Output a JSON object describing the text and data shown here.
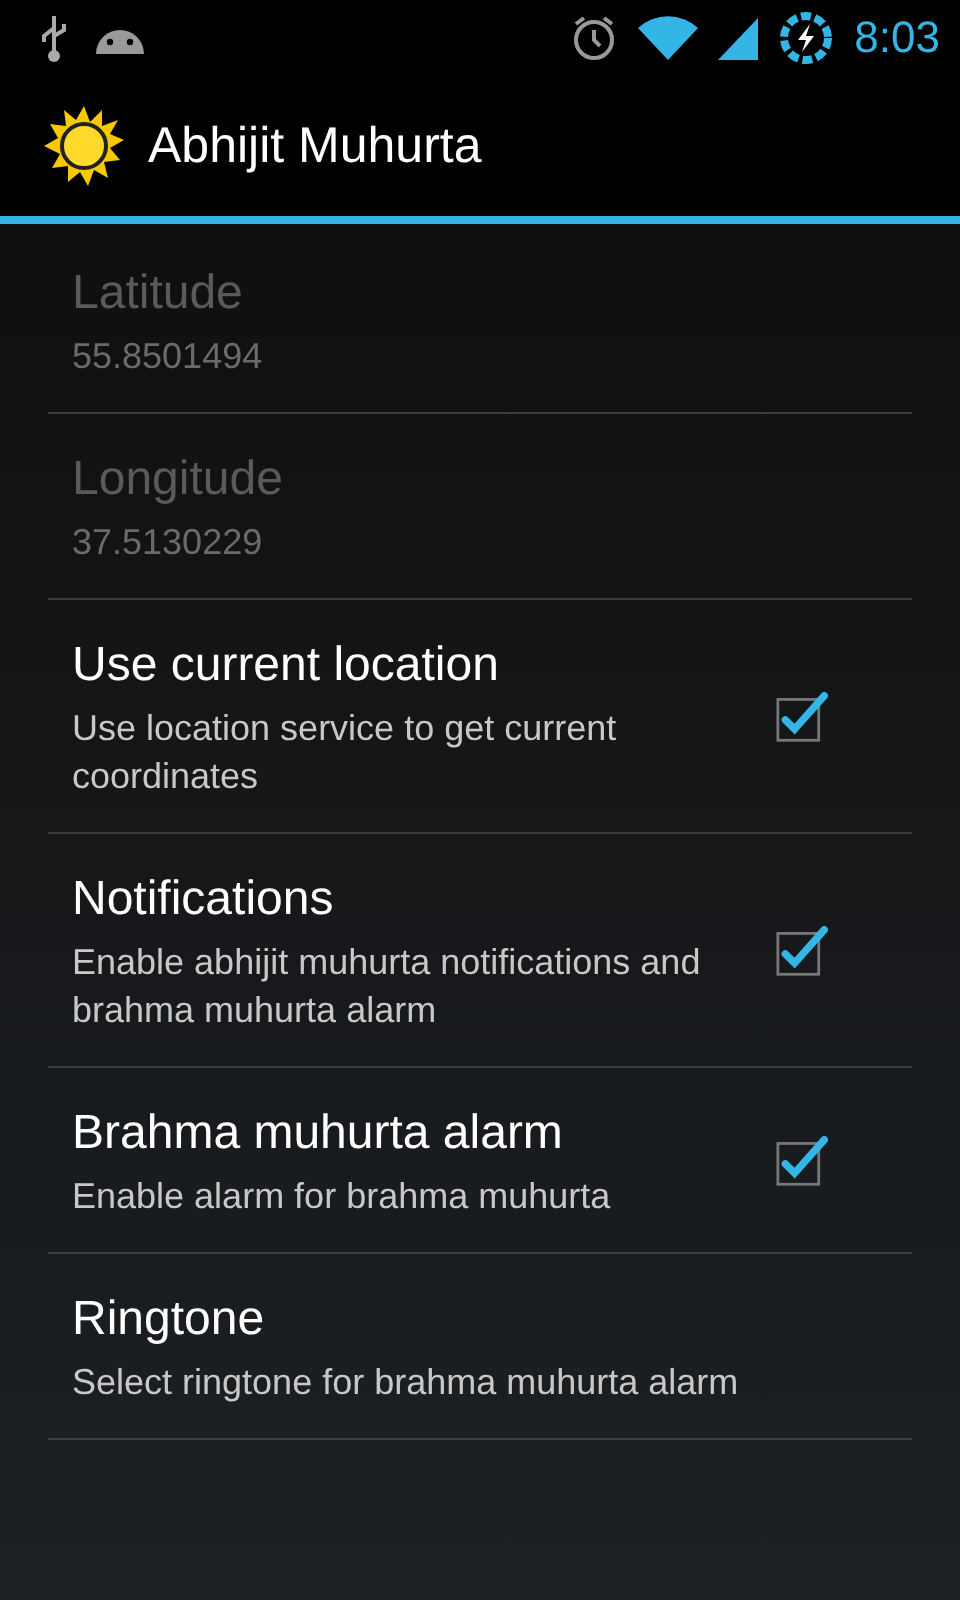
{
  "status_bar": {
    "time": "8:03"
  },
  "action_bar": {
    "title": "Abhijit Muhurta"
  },
  "preferences": [
    {
      "kind": "text",
      "title": "Latitude",
      "summary": "55.8501494",
      "disabled": true
    },
    {
      "kind": "text",
      "title": "Longitude",
      "summary": "37.5130229",
      "disabled": true
    },
    {
      "kind": "checkbox",
      "title": "Use current location",
      "summary": "Use location service to get current coordinates",
      "disabled": false,
      "checked": true
    },
    {
      "kind": "checkbox",
      "title": "Notifications",
      "summary": "Enable abhijit muhurta notifications and brahma muhurta alarm",
      "disabled": false,
      "checked": true
    },
    {
      "kind": "checkbox",
      "title": "Brahma muhurta alarm",
      "summary": "Enable alarm for brahma muhurta",
      "disabled": false,
      "checked": true
    },
    {
      "kind": "text",
      "title": "Ringtone",
      "summary": "Select ringtone for brahma muhurta alarm",
      "disabled": false
    }
  ]
}
